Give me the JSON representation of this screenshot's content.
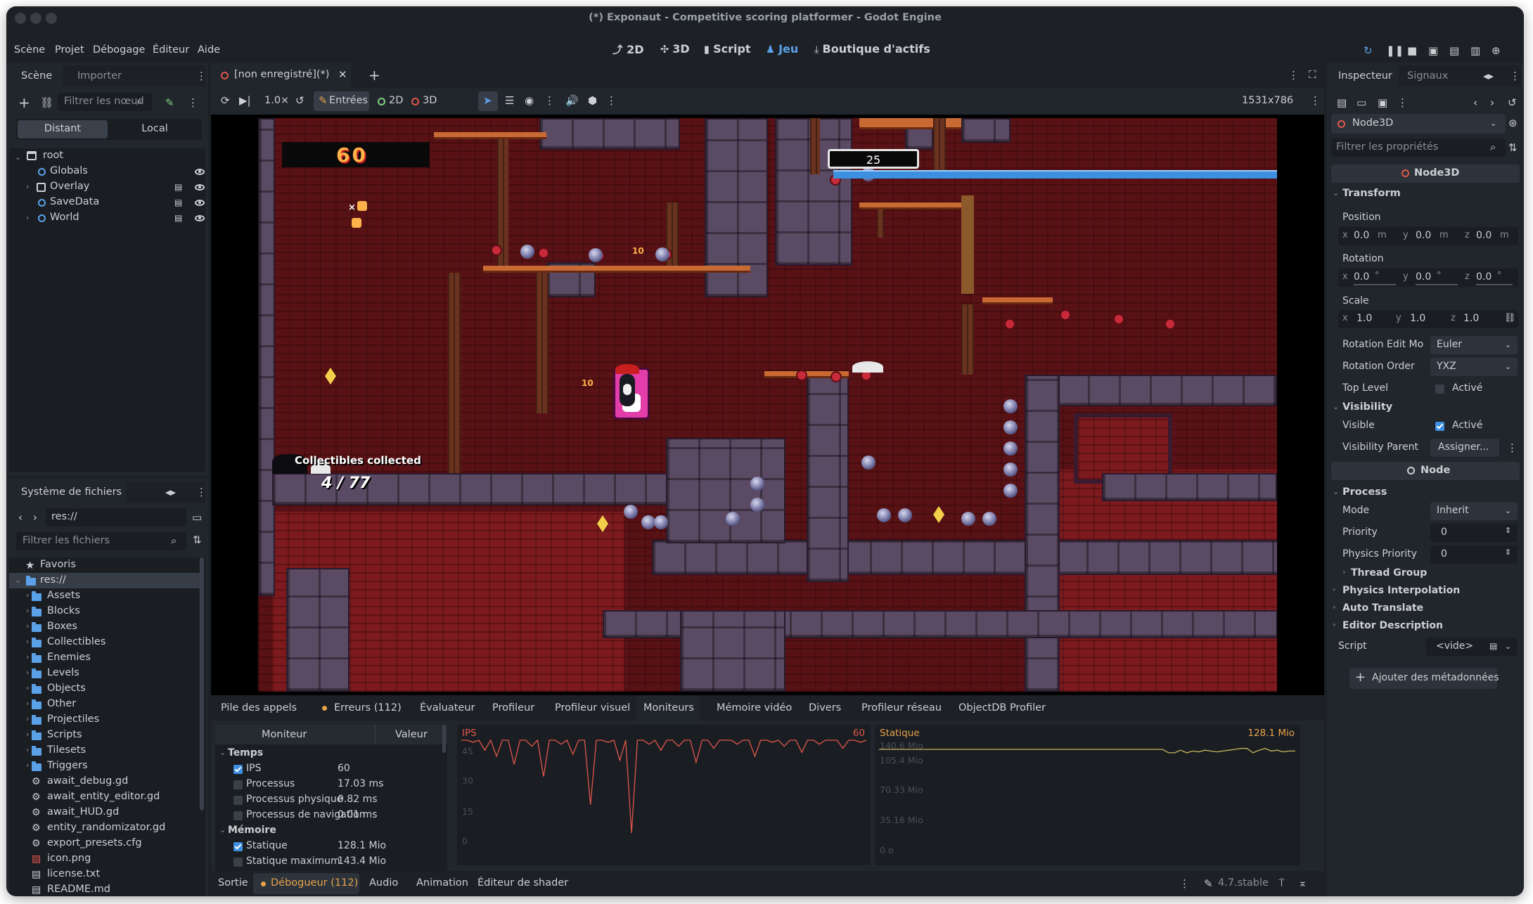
{
  "window": {
    "title": "(*) Exponaut - Competitive scoring platformer - Godot Engine"
  },
  "menu": [
    "Scène",
    "Projet",
    "Débogage",
    "Éditeur",
    "Aide"
  ],
  "workspaces": [
    {
      "icon": "2d-icon",
      "label": "2D"
    },
    {
      "icon": "3d-icon",
      "label": "3D"
    },
    {
      "icon": "script-icon",
      "label": "Script"
    },
    {
      "icon": "game-icon",
      "label": "Jeu",
      "active": true
    },
    {
      "icon": "assetlib-icon",
      "label": "Boutique d'actifs"
    }
  ],
  "scene_dock": {
    "tabs": [
      "Scène",
      "Importer"
    ],
    "filter_placeholder": "Filtrer les nœud",
    "toggle": [
      "Distant",
      "Local"
    ],
    "tree": [
      {
        "label": "root",
        "depth": 0,
        "icon": "window-icon"
      },
      {
        "label": "Globals",
        "depth": 1,
        "icon": "node-icon",
        "visible": true
      },
      {
        "label": "Overlay",
        "depth": 1,
        "icon": "control-icon",
        "visible": true,
        "expandable": true
      },
      {
        "label": "SaveData",
        "depth": 1,
        "icon": "node-icon",
        "visible": true
      },
      {
        "label": "World",
        "depth": 1,
        "icon": "node-icon",
        "visible": true,
        "expandable": true
      }
    ]
  },
  "fs_dock": {
    "title": "Système de fichiers",
    "path": "res://",
    "filter_placeholder": "Filtrer les fichiers",
    "favorites": "Favoris",
    "root": "res://",
    "folders": [
      "Assets",
      "Blocks",
      "Boxes",
      "Collectibles",
      "Enemies",
      "Levels",
      "Objects",
      "Other",
      "Projectiles",
      "Scripts",
      "Tilesets",
      "Triggers"
    ],
    "files": [
      {
        "name": "await_debug.gd",
        "icon": "gear-icon"
      },
      {
        "name": "await_entity_editor.gd",
        "icon": "gear-icon"
      },
      {
        "name": "await_HUD.gd",
        "icon": "gear-icon"
      },
      {
        "name": "entity_randomizator.gd",
        "icon": "gear-icon"
      },
      {
        "name": "export_presets.cfg",
        "icon": "config-icon"
      },
      {
        "name": "icon.png",
        "icon": "image-icon"
      },
      {
        "name": "license.txt",
        "icon": "text-icon"
      },
      {
        "name": "README.md",
        "icon": "text-icon"
      }
    ]
  },
  "editor_tab": {
    "label": "[non enregistré](*)"
  },
  "game_toolbar": {
    "zoom": "1.0×",
    "inputs": "Entrées",
    "mode2d": "2D",
    "mode3d": "3D",
    "resolution": "1531x786"
  },
  "game": {
    "hud_score": "60",
    "score_box": "25",
    "collect_title": "Collectibles collected",
    "collect_count": "4 / 77",
    "float_10": "10",
    "float_x": "×"
  },
  "debugger": {
    "tabs": [
      "Pile des appels",
      "Erreurs (112)",
      "Évaluateur",
      "Profileur",
      "Profileur visuel",
      "Moniteurs",
      "Mémoire vidéo",
      "Divers",
      "Profileur réseau",
      "ObjectDB Profiler"
    ],
    "active_tab": "Moniteurs",
    "col_monitor": "Moniteur",
    "col_value": "Valeur",
    "monitors": [
      {
        "type": "group",
        "label": "Temps"
      },
      {
        "type": "item",
        "label": "IPS",
        "value": "60",
        "checked": true
      },
      {
        "type": "item",
        "label": "Processus",
        "value": "17.03 ms",
        "checked": false
      },
      {
        "type": "item",
        "label": "Processus physique",
        "value": "0.82 ms",
        "checked": false
      },
      {
        "type": "item",
        "label": "Processus de navigation",
        "value": "0.01 ms",
        "checked": false
      },
      {
        "type": "group",
        "label": "Mémoire"
      },
      {
        "type": "item",
        "label": "Statique",
        "value": "128.1 Mio",
        "checked": true
      },
      {
        "type": "item",
        "label": "Statique maximum",
        "value": "143.4 Mio",
        "checked": false
      }
    ],
    "graph_ips": {
      "title": "IPS",
      "value": "60",
      "ticks": [
        "45",
        "30",
        "15",
        "0"
      ]
    },
    "graph_static": {
      "title": "Statique",
      "value": "128.1 Mio",
      "ticks": [
        "140.6 Mio",
        "105.4 Mio",
        "70.33 Mio",
        "35.16 Mio",
        "0 o"
      ]
    }
  },
  "bottom_bar": {
    "tabs": [
      "Sortie",
      "Débogueur (112)",
      "Audio",
      "Animation",
      "Éditeur de shader"
    ],
    "version": "4.7.stable"
  },
  "inspector": {
    "tabs": [
      "Inspecteur",
      "Signaux"
    ],
    "node_select": "Node3D",
    "filter_placeholder": "Filtrer les propriétés",
    "class_header": "Node3D",
    "transform": "Transform",
    "position_label": "Position",
    "position": {
      "x": "0.0",
      "y": "0.0",
      "z": "0.0",
      "unit": "m"
    },
    "rotation_label": "Rotation",
    "rotation": {
      "x": "0.0",
      "y": "0.0",
      "z": "0.0",
      "unit": "°"
    },
    "scale_label": "Scale",
    "scale": {
      "x": "1.0",
      "y": "1.0",
      "z": "1.0"
    },
    "rotation_edit_label": "Rotation Edit Mo",
    "rotation_edit": "Euler",
    "rotation_order_label": "Rotation Order",
    "rotation_order": "YXZ",
    "top_level_label": "Top Level",
    "active": "Activé",
    "visibility": "Visibility",
    "visible_label": "Visible",
    "visibility_parent_label": "Visibility Parent",
    "assign": "Assigner...",
    "node_header": "Node",
    "process": "Process",
    "mode_label": "Mode",
    "mode": "Inherit",
    "priority_label": "Priority",
    "priority": "0",
    "physics_priority_label": "Physics Priority",
    "physics_priority": "0",
    "thread_group": "Thread Group",
    "physics_interp": "Physics Interpolation",
    "auto_translate": "Auto Translate",
    "editor_desc": "Editor Description",
    "script_label": "Script",
    "script_value": "<vide>",
    "add_meta": "Ajouter des métadonnées"
  },
  "colors": {
    "accent": "#5ba1e8",
    "error": "#e0564a",
    "warning": "#e8a24a",
    "panel": "#21262c"
  },
  "chart_data": [
    {
      "type": "line",
      "title": "IPS",
      "ylim": [
        0,
        60
      ],
      "series": [
        {
          "name": "IPS",
          "values": [
            60,
            60,
            59,
            60,
            55,
            60,
            52,
            60,
            60,
            48,
            60,
            60,
            57,
            60,
            42,
            60,
            60,
            58,
            60,
            53,
            60,
            60,
            28,
            60,
            60,
            59,
            60,
            50,
            60,
            14,
            60,
            60,
            58,
            60,
            55,
            60,
            60,
            57,
            60,
            60,
            49,
            60,
            60,
            56,
            60,
            60,
            60,
            58,
            60,
            60,
            52,
            60,
            60,
            59,
            60,
            57,
            60,
            60,
            54,
            60,
            60,
            58,
            60,
            60,
            60,
            56,
            60,
            60,
            59,
            60
          ]
        }
      ]
    },
    {
      "type": "line",
      "title": "Statique",
      "ylim": [
        0,
        140.6
      ],
      "series": [
        {
          "name": "Statique",
          "values": [
            130,
            130,
            130,
            130,
            130,
            130,
            130,
            130,
            130,
            130,
            130,
            130,
            130,
            130,
            130,
            130,
            130,
            130,
            130,
            130,
            130,
            130,
            130,
            130,
            130,
            130,
            130,
            130,
            130,
            130,
            130,
            130,
            130,
            130,
            130,
            130,
            130,
            130,
            130,
            130,
            130,
            130,
            130,
            130,
            130,
            130,
            130,
            130,
            126,
            126,
            129,
            126,
            128,
            127,
            129,
            128,
            127,
            128,
            129,
            130,
            131,
            131,
            126,
            129,
            131,
            128,
            129,
            127,
            128,
            128
          ]
        }
      ]
    }
  ]
}
